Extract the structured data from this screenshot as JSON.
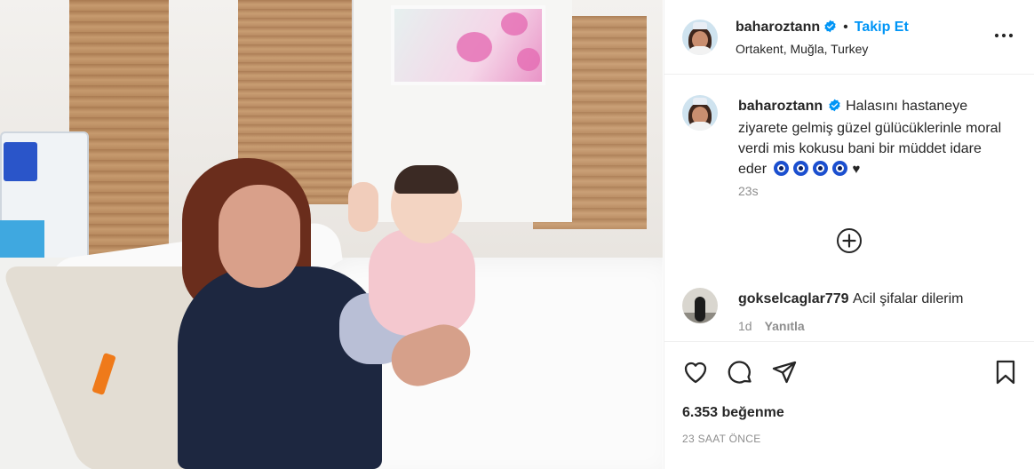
{
  "post": {
    "username": "baharoztann",
    "follow_label": "Takip Et",
    "separator": "•",
    "location": "Ortakent, Muğla, Turkey",
    "caption_text": "Halasını hastaneye ziyarete gelmiş güzel gülücüklerinle moral verdi mis kokusu bani bir müddet idare eder",
    "caption_emoji_count": 4,
    "caption_trailing": "♥",
    "caption_time": "23s",
    "likes": "6.353 beğenme",
    "posted_ago": "23 SAAT ÖNCE"
  },
  "comment": {
    "username": "gokselcaglar779",
    "text": "Acil şifalar dilerim",
    "age": "1d",
    "reply_label": "Yanıtla"
  },
  "icons": {
    "verified": "verified-badge-icon",
    "more": "more-options-icon",
    "load_more": "load-more-comments-icon",
    "like": "heart-icon",
    "comment": "comment-icon",
    "share": "share-icon",
    "save": "bookmark-icon"
  },
  "colors": {
    "accent": "#0095f6",
    "text": "#262626",
    "muted": "#8e8e8e",
    "divider": "#efefef"
  }
}
